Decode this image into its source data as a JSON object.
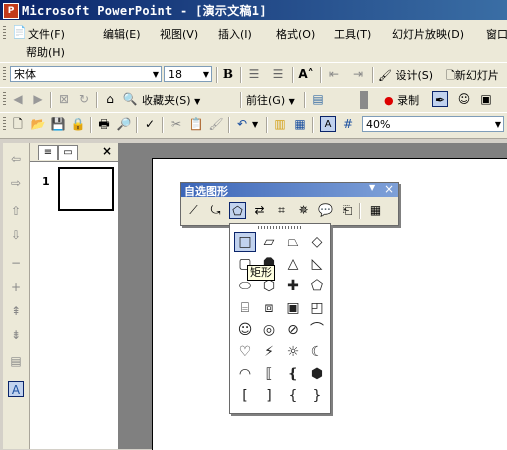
{
  "window": {
    "app_icon": "powerpoint-icon",
    "title": "Microsoft PowerPoint - [演示文稿1]"
  },
  "menubar": {
    "items": [
      {
        "label": "文件(F)",
        "name": "menu-file"
      },
      {
        "label": "编辑(E)",
        "name": "menu-edit"
      },
      {
        "label": "视图(V)",
        "name": "menu-view"
      },
      {
        "label": "插入(I)",
        "name": "menu-insert"
      },
      {
        "label": "格式(O)",
        "name": "menu-format"
      },
      {
        "label": "工具(T)",
        "name": "menu-tools"
      },
      {
        "label": "幻灯片放映(D)",
        "name": "menu-slideshow"
      },
      {
        "label": "窗口",
        "name": "menu-window"
      },
      {
        "label": "帮助(H)",
        "name": "menu-help"
      }
    ]
  },
  "format_toolbar": {
    "font_name": "宋体",
    "font_size": "18",
    "bold": "B",
    "design_label": "设计(S)",
    "new_slide_label": "新幻灯片"
  },
  "web_toolbar": {
    "favorites_label": "收藏夹(S)",
    "goto_label": "前往(G)",
    "record_label": "录制"
  },
  "standard_toolbar": {
    "zoom": "40%"
  },
  "slide_pane": {
    "slide_number": "1"
  },
  "autoshapes": {
    "title": "自选图形",
    "tooltip": "矩形",
    "palette_rows": [
      [
        "rectangle-icon",
        "parallelogram-icon",
        "trapezoid-icon",
        "diamond-icon"
      ],
      [
        "rounded-rectangle-icon",
        "octagon-icon",
        "triangle-icon",
        "right-triangle-icon"
      ],
      [
        "oval-icon",
        "hexagon-icon",
        "cross-icon",
        "pentagon-icon"
      ],
      [
        "can-icon",
        "cube-icon",
        "bevel-icon",
        "folded-corner-icon"
      ],
      [
        "smiley-icon",
        "donut-icon",
        "no-symbol-icon",
        "block-arc-icon"
      ],
      [
        "heart-icon",
        "lightning-icon",
        "sun-icon",
        "moon-icon"
      ],
      [
        "arc-icon",
        "double-bracket-icon",
        "double-brace-icon",
        "plaque-icon"
      ],
      [
        "left-bracket-icon",
        "right-bracket-icon",
        "left-brace-icon",
        "right-brace-icon"
      ]
    ]
  }
}
